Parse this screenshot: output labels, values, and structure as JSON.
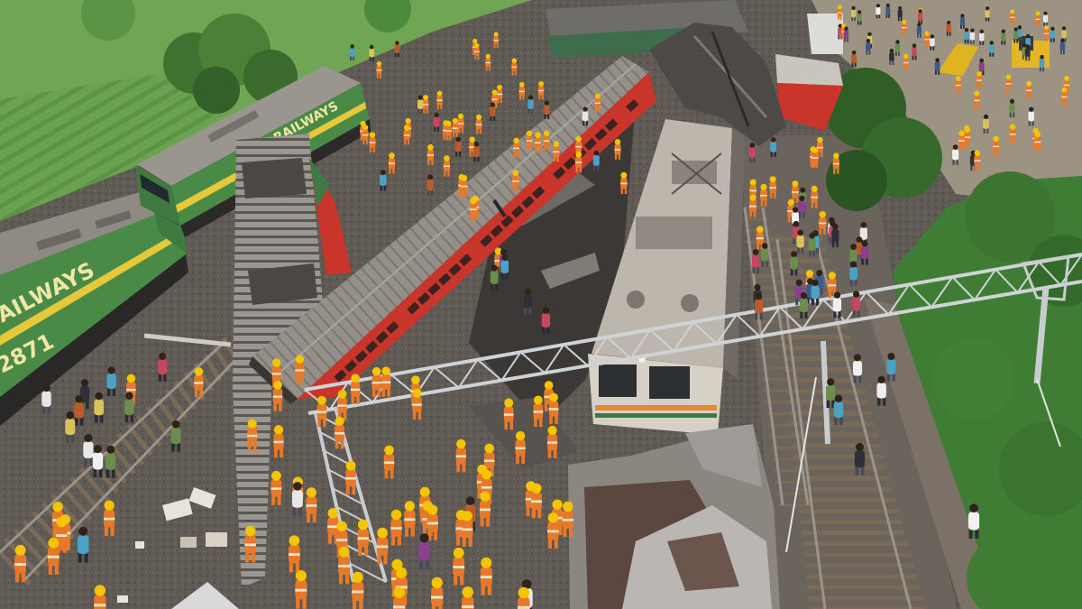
{
  "locomotive_left": {
    "livery_text": "AILWAYS",
    "number": "2871"
  },
  "locomotive_top": {
    "livery_text": "N RAILWAYS"
  },
  "colors": {
    "rescue_uniform": "#e8792a",
    "helmet": "#f2c500",
    "coach_red": "#c9352b",
    "loco_green": "#4a8a47",
    "loco_stripe": "#e6c93a",
    "vegetation": "#3f7c34",
    "field": "#6fa553",
    "gantry_steel": "#cfd3d6"
  }
}
